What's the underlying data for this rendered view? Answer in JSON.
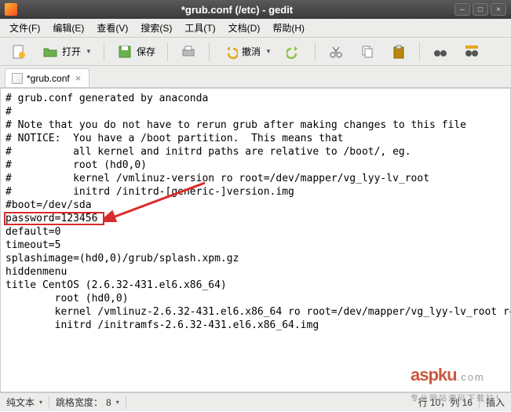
{
  "window": {
    "title": "*grub.conf (/etc) - gedit"
  },
  "menu": {
    "file": "文件(F)",
    "edit": "编辑(E)",
    "view": "查看(V)",
    "search": "搜索(S)",
    "tools": "工具(T)",
    "documents": "文档(D)",
    "help": "帮助(H)"
  },
  "toolbar": {
    "open": "打开",
    "save": "保存",
    "undo": "撤消"
  },
  "tab": {
    "label": "*grub.conf"
  },
  "editor": {
    "content": "# grub.conf generated by anaconda\n#\n# Note that you do not have to rerun grub after making changes to this file\n# NOTICE:  You have a /boot partition.  This means that\n#          all kernel and initrd paths are relative to /boot/, eg.\n#          root (hd0,0)\n#          kernel /vmlinuz-version ro root=/dev/mapper/vg_lyy-lv_root\n#          initrd /initrd-[generic-]version.img\n#boot=/dev/sda\npassword=123456\ndefault=0\ntimeout=5\nsplashimage=(hd0,0)/grub/splash.xpm.gz\nhiddenmenu\ntitle CentOS (2.6.32-431.el6.x86_64)\n        root (hd0,0)\n        kernel /vmlinuz-2.6.32-431.el6.x86_64 ro root=/dev/mapper/vg_lyy-lv_root rd_LVM_LV=vg_lyy/lv_swap rd_NO_LUKS rd_NO_MD crashkernel=auto LANG=zh_CN.UTF-8 rd_LVM_LV=vg_lyy/lv_root  KEYBOARDTYPE=pc KEYTABLE=us rd_NO_DM rhgb quiet\n        initrd /initramfs-2.6.32-431.el6.x86_64.img"
  },
  "statusbar": {
    "mode": "纯文本",
    "tabwidth_label": "跳格宽度：",
    "tabwidth_value": "8",
    "position": "行 10，列 16",
    "insert": "插入"
  },
  "watermark": {
    "brand": "aspku",
    "domain": ".com",
    "tagline": "专业网站源码下载站！"
  }
}
